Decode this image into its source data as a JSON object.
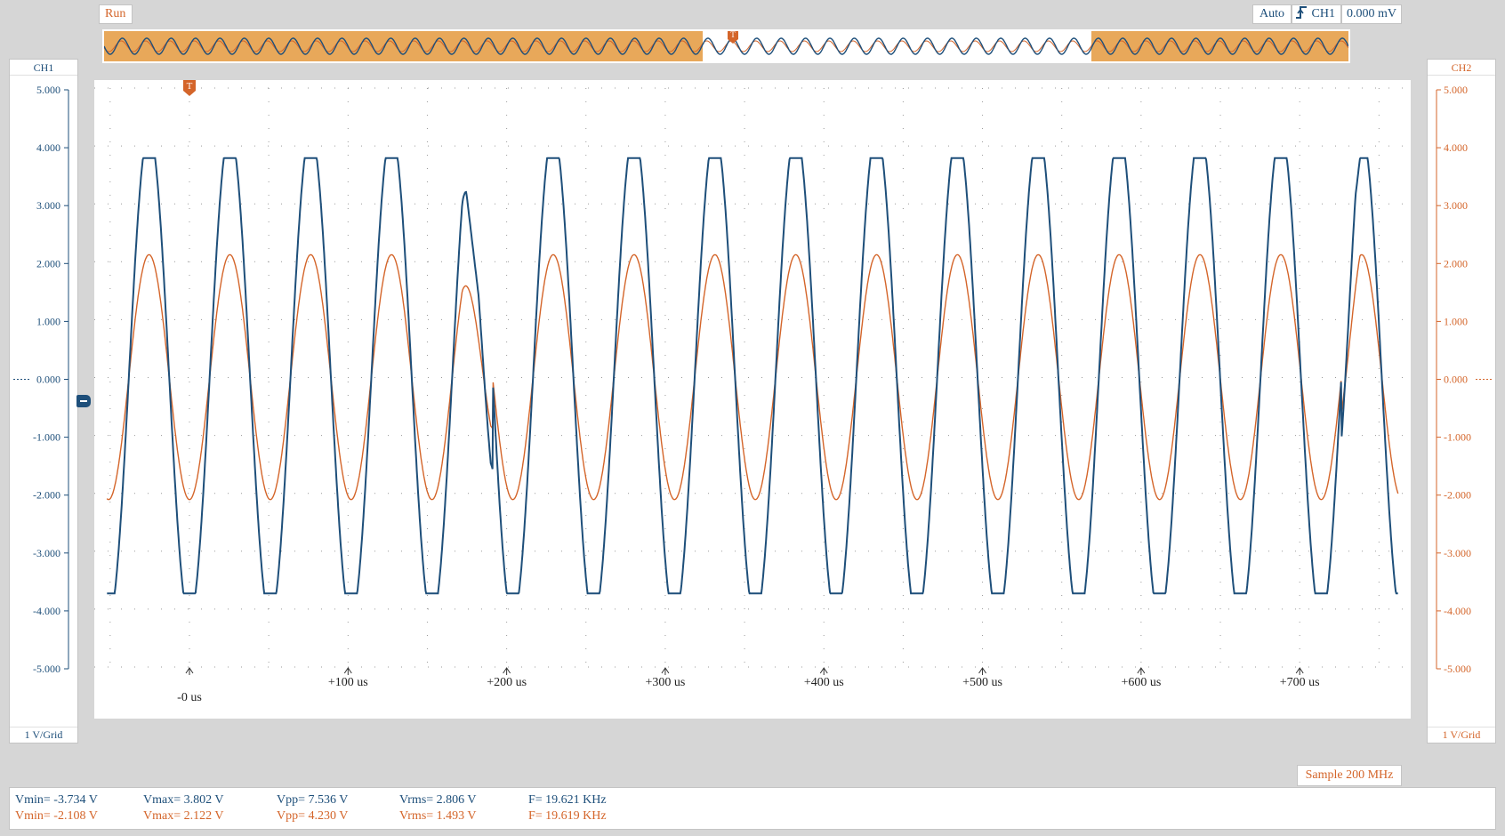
{
  "toolbar": {
    "run_status": "Run",
    "trigger_mode": "Auto",
    "trigger_source": "CH1",
    "trigger_level": "0.000 mV",
    "trigger_edge_icon": "rising-edge-icon"
  },
  "channels": {
    "ch1": {
      "name": "CH1",
      "scale": "1 V/Grid",
      "color": "#1e4f7a",
      "ticks": [
        "5.000",
        "4.000",
        "3.000",
        "2.000",
        "1.000",
        "0.000",
        "-1.000",
        "-2.000",
        "-3.000",
        "-4.000",
        "-5.000"
      ]
    },
    "ch2": {
      "name": "CH2",
      "scale": "1 V/Grid",
      "color": "#d4652a",
      "ticks": [
        "5.000",
        "4.000",
        "3.000",
        "2.000",
        "1.000",
        "0.000",
        "-1.000",
        "-2.000",
        "-3.000",
        "-4.000",
        "-5.000"
      ]
    }
  },
  "time_axis": {
    "labels": [
      "-0 us",
      "+100 us",
      "+200 us",
      "+300 us",
      "+400 us",
      "+500 us",
      "+600 us",
      "+700 us"
    ],
    "values": [
      0,
      100,
      200,
      300,
      400,
      500,
      600,
      700
    ]
  },
  "trigger_marker": {
    "label": "T"
  },
  "sample_rate": "Sample 200 MHz",
  "measurements": {
    "ch1": {
      "vmin": "Vmin= -3.734 V",
      "vmax": "Vmax= 3.802 V",
      "vpp": "Vpp= 7.536 V",
      "vrms": "Vrms= 2.806 V",
      "freq": "F= 19.621 KHz"
    },
    "ch2": {
      "vmin": "Vmin= -2.108 V",
      "vmax": "Vmax= 2.122 V",
      "vpp": "Vpp= 4.230 V",
      "vrms": "Vrms= 1.493 V",
      "freq": "F= 19.619 KHz"
    }
  },
  "chart_data": {
    "type": "line",
    "x_range_us": [
      -60,
      770
    ],
    "y_range_v": [
      -5,
      5
    ],
    "grid": true,
    "series": [
      {
        "name": "CH1",
        "color": "#1e4f7a",
        "frequency_khz": 19.621,
        "vmin": -3.734,
        "vmax": 3.802
      },
      {
        "name": "CH2",
        "color": "#d4652a",
        "frequency_khz": 19.619,
        "vmin": -2.108,
        "vmax": 2.122
      }
    ]
  }
}
